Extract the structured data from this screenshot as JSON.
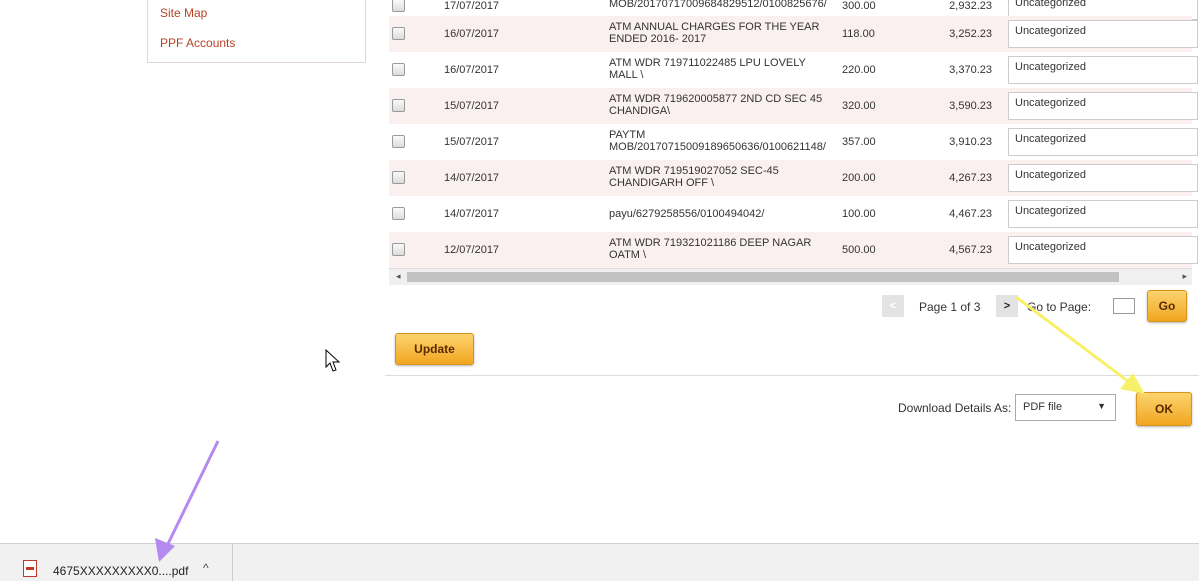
{
  "sidebar": {
    "links": [
      {
        "label": "Site Map"
      },
      {
        "label": "PPF Accounts"
      }
    ]
  },
  "transactions": {
    "partial_row": {
      "date": "17/07/2017",
      "desc": "MOB/20170717009684829512/0100825676/",
      "withdrawal": "300.00",
      "balance": "2,932.23",
      "category": "Uncategorized"
    },
    "rows": [
      {
        "date": "16/07/2017",
        "desc": "ATM ANNUAL CHARGES FOR THE YEAR ENDED 2016- 2017",
        "withdrawal": "118.00",
        "balance": "3,252.23",
        "category": "Uncategorized"
      },
      {
        "date": "16/07/2017",
        "desc": "ATM WDR 719711022485 LPU LOVELY MALL \\",
        "withdrawal": "220.00",
        "balance": "3,370.23",
        "category": "Uncategorized"
      },
      {
        "date": "15/07/2017",
        "desc": "ATM WDR 719620005877 2ND CD SEC 45 CHANDIGA\\",
        "withdrawal": "320.00",
        "balance": "3,590.23",
        "category": "Uncategorized"
      },
      {
        "date": "15/07/2017",
        "desc": "PAYTM MOB/20170715009189650636/0100621148/",
        "withdrawal": "357.00",
        "balance": "3,910.23",
        "category": "Uncategorized"
      },
      {
        "date": "14/07/2017",
        "desc": "ATM WDR 719519027052 SEC-45 CHANDIGARH OFF \\",
        "withdrawal": "200.00",
        "balance": "4,267.23",
        "category": "Uncategorized"
      },
      {
        "date": "14/07/2017",
        "desc": "payu/6279258556/0100494042/",
        "withdrawal": "100.00",
        "balance": "4,467.23",
        "category": "Uncategorized"
      },
      {
        "date": "12/07/2017",
        "desc": "ATM WDR 719321021186 DEEP NAGAR OATM \\",
        "withdrawal": "500.00",
        "balance": "4,567.23",
        "category": "Uncategorized"
      }
    ]
  },
  "pagination": {
    "prev": "<",
    "page_text": "Page 1 of 3",
    "next": ">",
    "goto_label": "Go to Page:",
    "goto_value": "",
    "go_button": "Go"
  },
  "actions": {
    "update_button": "Update"
  },
  "download": {
    "label": "Download Details As:",
    "selected_format": "PDF file",
    "ok_button": "OK"
  },
  "download_bar": {
    "file_name": "4675XXXXXXXXX0....pdf"
  },
  "colors": {
    "accent_button": "#f3b12e",
    "link": "#b54224",
    "annotation_yellow": "#f6f06a",
    "annotation_purple": "#b48af0"
  }
}
